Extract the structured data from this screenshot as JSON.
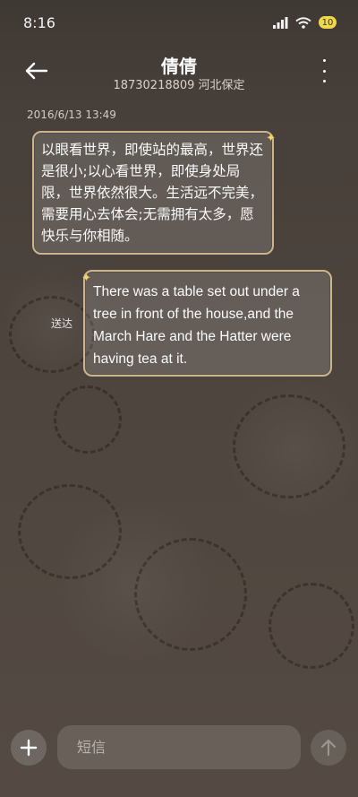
{
  "status_bar": {
    "time": "8:16",
    "battery_level": "10",
    "icons": [
      "signal-icon",
      "wifi-icon",
      "battery-icon"
    ]
  },
  "header": {
    "title": "倩倩",
    "subtitle": "18730218809 河北保定",
    "icons": [
      "back-arrow-icon",
      "more-vertical-icon"
    ]
  },
  "conversation": {
    "timestamp": "2016/6/13 13:49",
    "messages": [
      {
        "direction": "incoming",
        "text": "以眼看世界，即使站的最高，世界还是很小;以心看世界，即使身处局限，世界依然很大。生活远不完美，需要用心去体会;无需拥有太多，愿快乐与你相随。"
      },
      {
        "direction": "outgoing",
        "status": "送达",
        "text": "There was a table set out under a tree in front of the house,and the March Hare and the Hatter were having tea at it."
      }
    ]
  },
  "composer": {
    "placeholder": "短信",
    "icons": [
      "plus-icon",
      "send-arrow-icon"
    ]
  },
  "colors": {
    "accent_border": "#cdb58b",
    "star": "#f3d46b",
    "battery": "#f0d84a"
  }
}
